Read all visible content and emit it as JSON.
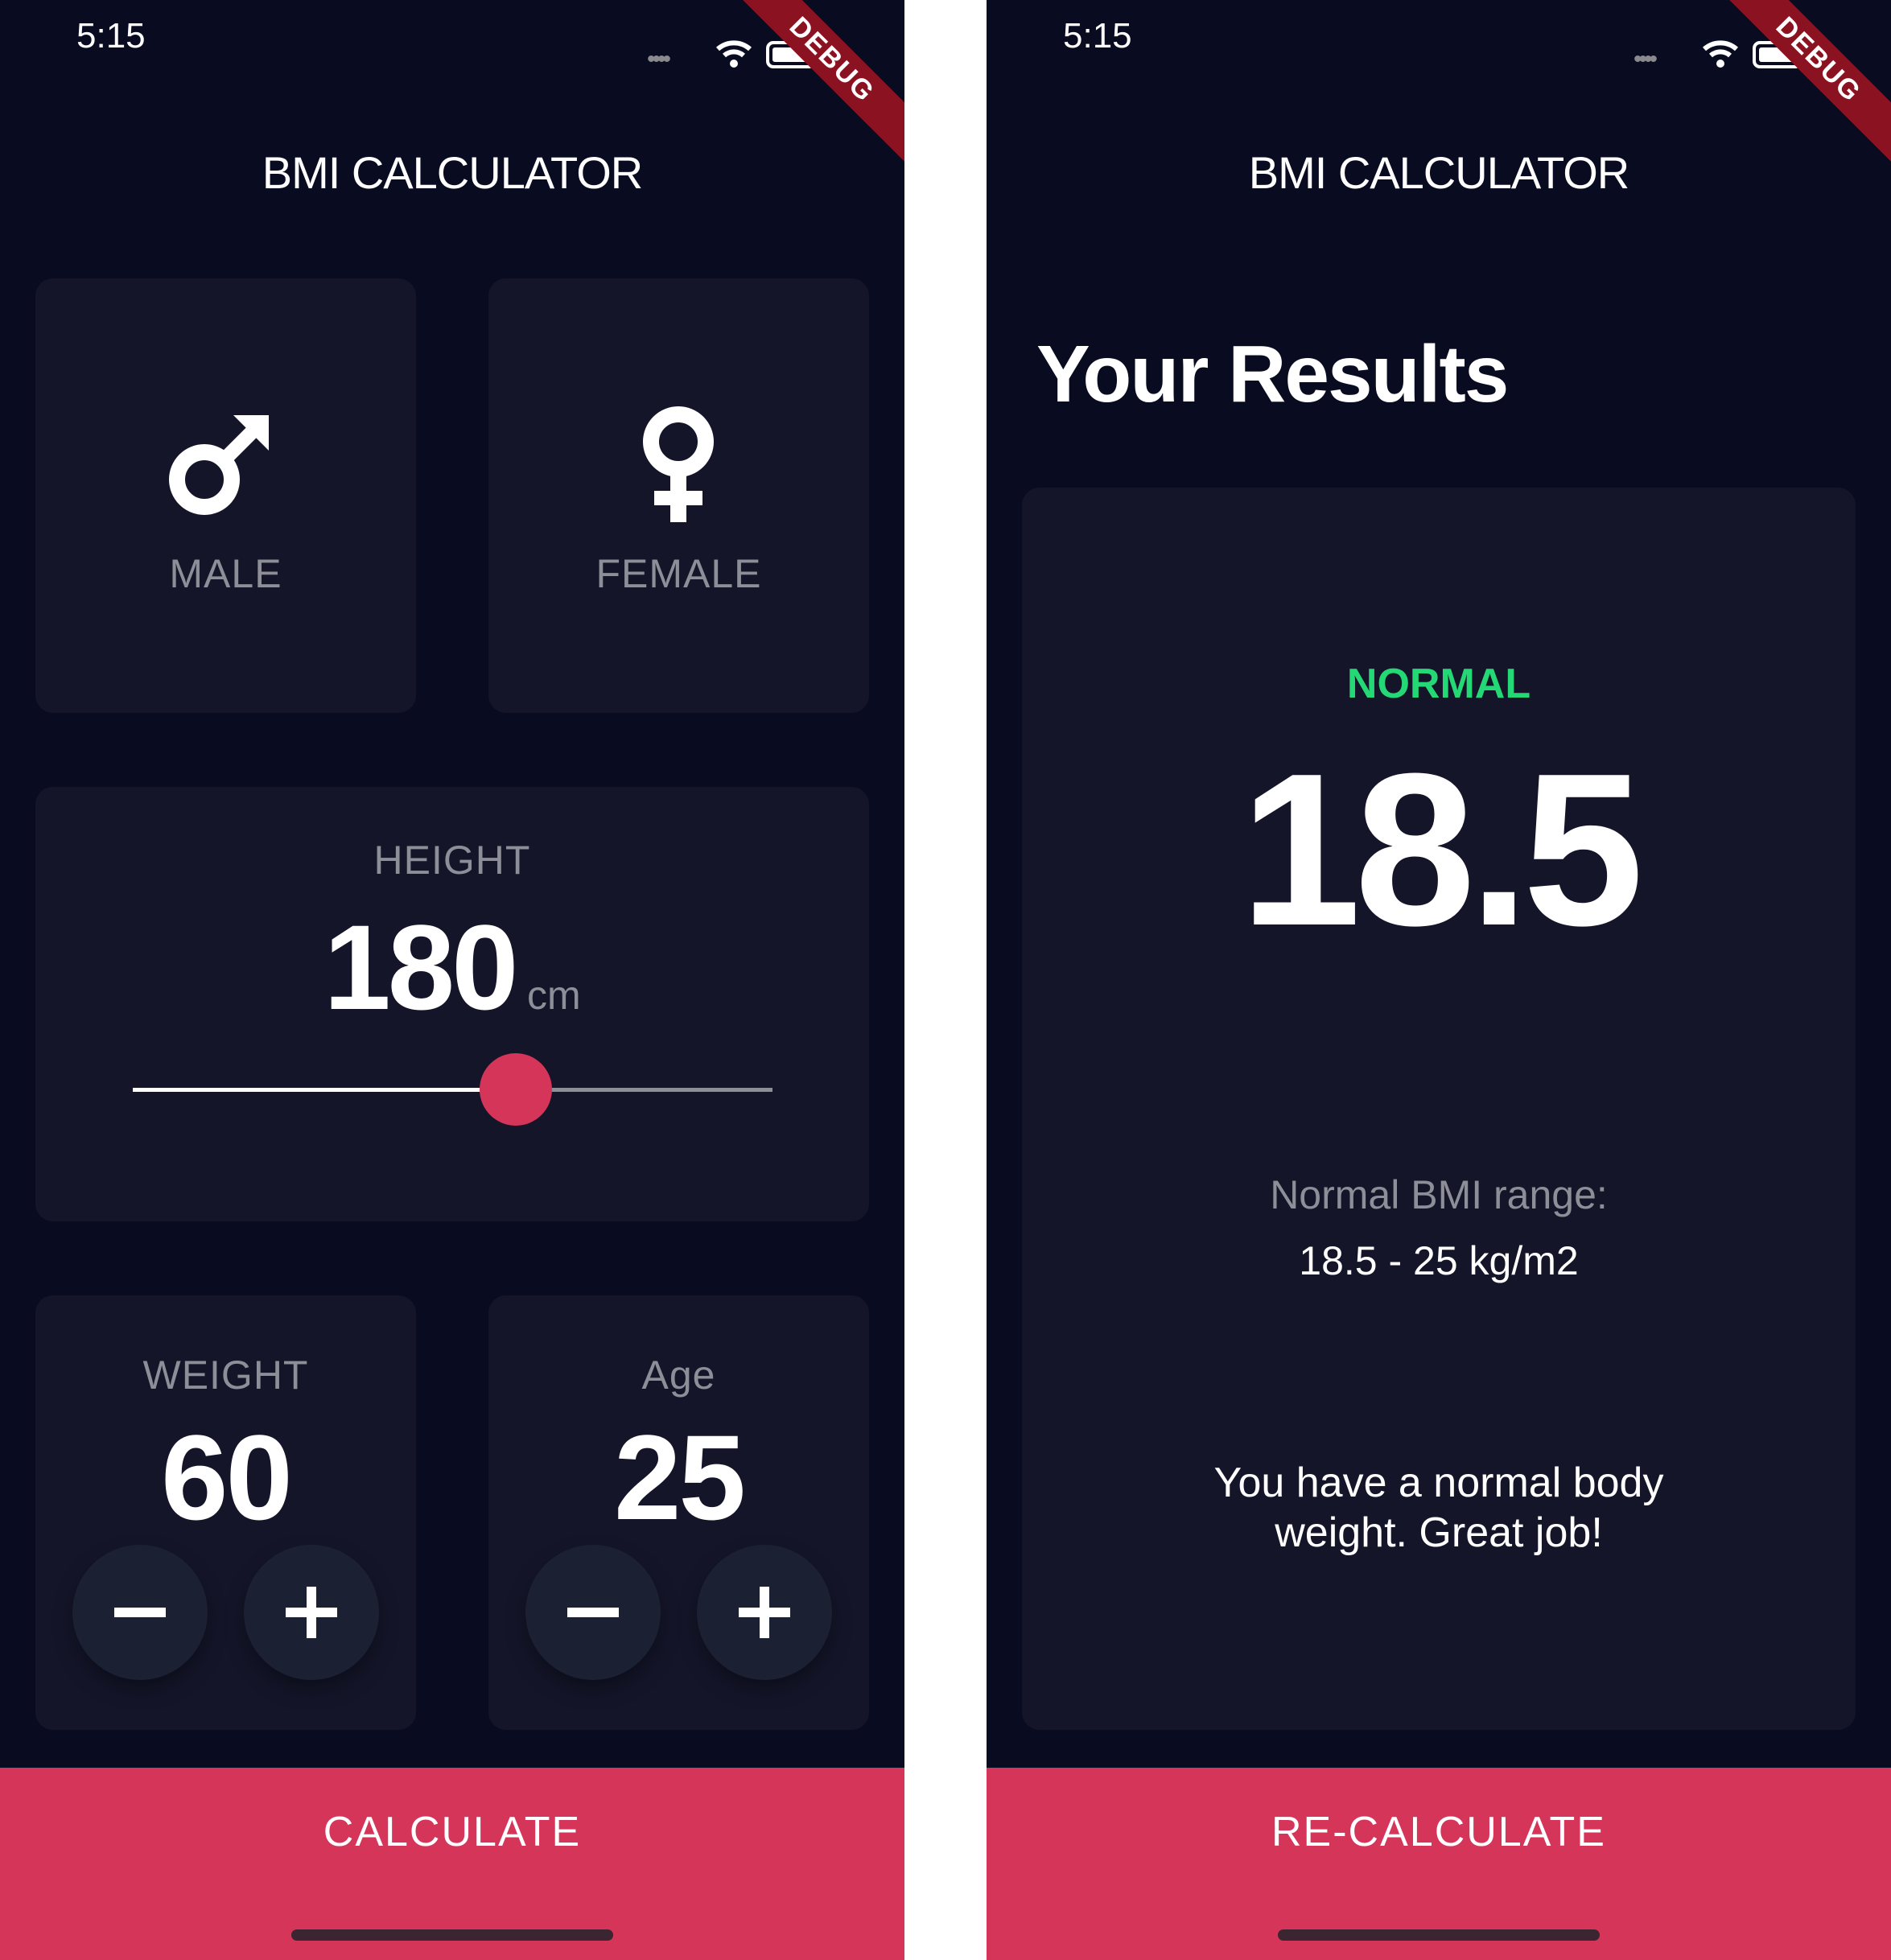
{
  "left": {
    "status": {
      "time": "5:15"
    },
    "debug_banner": "DEBUG",
    "title": "BMI CALCULATOR",
    "gender_cards": [
      {
        "label": "MALE",
        "icon": "male-symbol-icon"
      },
      {
        "label": "FEMALE",
        "icon": "female-symbol-icon"
      }
    ],
    "height": {
      "label": "HEIGHT",
      "value": "180",
      "unit": "cm",
      "slider_fraction": 0.6
    },
    "weight": {
      "label": "WEIGHT",
      "value": "60"
    },
    "age": {
      "label": "Age",
      "value": "25"
    },
    "action": {
      "label": "CALCULATE"
    }
  },
  "right": {
    "status": {
      "time": "5:15"
    },
    "debug_banner": "DEBUG",
    "title": "BMI CALCULATOR",
    "heading": "Your Results",
    "result": {
      "category": "NORMAL",
      "bmi": "18.5",
      "range_label": "Normal BMI range:",
      "range_value": "18.5 - 25 kg/m2",
      "message": "You have a normal body weight. Great job!"
    },
    "action": {
      "label": "RE-CALCULATE"
    }
  },
  "colors": {
    "background": "#090c21",
    "card": "#141529",
    "accent": "#d6355a",
    "normal_green": "#24d876",
    "label_gray": "#8d8e98"
  }
}
